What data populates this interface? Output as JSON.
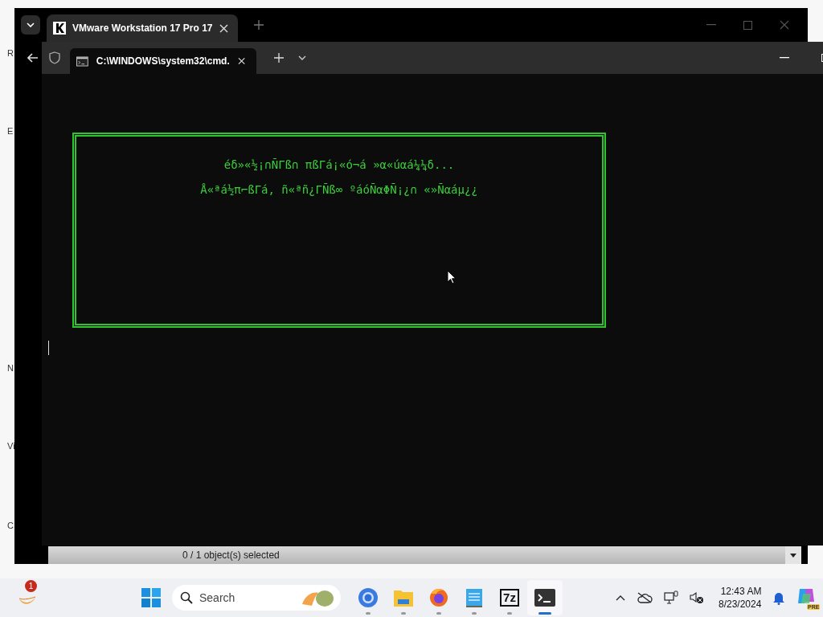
{
  "desktop": {
    "icon_labels": [
      "R",
      "E",
      "N",
      "Vi",
      "C"
    ]
  },
  "outer_window": {
    "tabs": [
      {
        "title": "VMware Workstation 17 Pro 17",
        "selected": true
      }
    ],
    "status_bar": "0 / 1 object(s) selected"
  },
  "terminal_window": {
    "tabs": [
      {
        "title": "C:\\WINDOWS\\system32\\cmd.",
        "selected": true
      }
    ],
    "dialog_lines": [
      "éδ»«½¡∩ÑΓß∩ πßΓá¡«ó¬á »α«úαá¼¼δ...",
      "Å«ªá½π⌐ßΓá, ñ«ªñ¿ΓÑß∞ ºáóÑαΦÑ¡¿∩ «»Ñαáµ¿¿"
    ]
  },
  "taskbar": {
    "widget_badge": "1",
    "search": {
      "placeholder": "Search"
    },
    "apps": [
      {
        "kind": "chrome",
        "active": false
      },
      {
        "kind": "files",
        "active": false
      },
      {
        "kind": "firefox",
        "active": false
      },
      {
        "kind": "notepad",
        "active": false
      },
      {
        "kind": "sevenzip",
        "label": "7z",
        "active": false
      },
      {
        "kind": "terminal",
        "active": true
      }
    ],
    "time": "12:43 AM",
    "date": "8/23/2024",
    "copilot_badge": "PRE"
  }
}
